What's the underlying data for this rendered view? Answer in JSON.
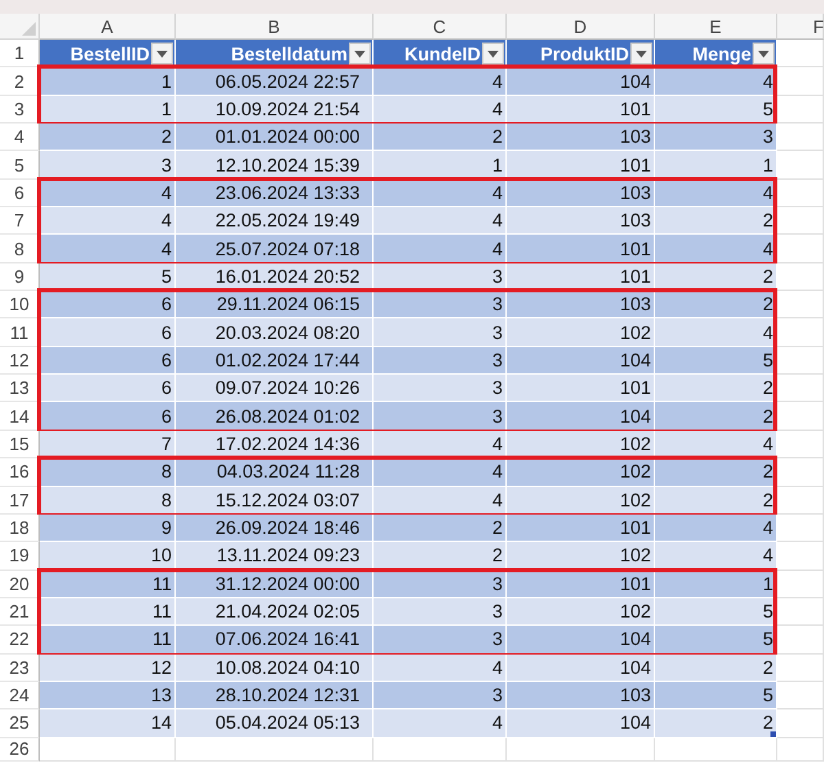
{
  "columns": [
    "A",
    "B",
    "C",
    "D",
    "E",
    "F"
  ],
  "header": {
    "row": "1",
    "cells": [
      "BestellID",
      "Bestelldatum",
      "KundeID",
      "ProduktID",
      "Menge"
    ]
  },
  "groups": [
    {
      "outlined": true,
      "rows": [
        {
          "row": "2",
          "cells": [
            "1",
            "06.05.2024 22:57",
            "4",
            "104",
            "4"
          ]
        },
        {
          "row": "3",
          "cells": [
            "1",
            "10.09.2024 21:54",
            "4",
            "101",
            "5"
          ]
        }
      ]
    },
    {
      "outlined": false,
      "rows": [
        {
          "row": "4",
          "cells": [
            "2",
            "01.01.2024 00:00",
            "2",
            "103",
            "3"
          ]
        },
        {
          "row": "5",
          "cells": [
            "3",
            "12.10.2024 15:39",
            "1",
            "101",
            "1"
          ]
        }
      ]
    },
    {
      "outlined": true,
      "rows": [
        {
          "row": "6",
          "cells": [
            "4",
            "23.06.2024 13:33",
            "4",
            "103",
            "4"
          ]
        },
        {
          "row": "7",
          "cells": [
            "4",
            "22.05.2024 19:49",
            "4",
            "103",
            "2"
          ]
        },
        {
          "row": "8",
          "cells": [
            "4",
            "25.07.2024 07:18",
            "4",
            "101",
            "4"
          ]
        }
      ]
    },
    {
      "outlined": false,
      "rows": [
        {
          "row": "9",
          "cells": [
            "5",
            "16.01.2024 20:52",
            "3",
            "101",
            "2"
          ]
        }
      ]
    },
    {
      "outlined": true,
      "rows": [
        {
          "row": "10",
          "cells": [
            "6",
            "29.11.2024 06:15",
            "3",
            "103",
            "2"
          ]
        },
        {
          "row": "11",
          "cells": [
            "6",
            "20.03.2024 08:20",
            "3",
            "102",
            "4"
          ]
        },
        {
          "row": "12",
          "cells": [
            "6",
            "01.02.2024 17:44",
            "3",
            "104",
            "5"
          ]
        },
        {
          "row": "13",
          "cells": [
            "6",
            "09.07.2024 10:26",
            "3",
            "101",
            "2"
          ]
        },
        {
          "row": "14",
          "cells": [
            "6",
            "26.08.2024 01:02",
            "3",
            "104",
            "2"
          ]
        }
      ]
    },
    {
      "outlined": false,
      "rows": [
        {
          "row": "15",
          "cells": [
            "7",
            "17.02.2024 14:36",
            "4",
            "102",
            "4"
          ]
        }
      ]
    },
    {
      "outlined": true,
      "rows": [
        {
          "row": "16",
          "cells": [
            "8",
            "04.03.2024 11:28",
            "4",
            "102",
            "2"
          ]
        },
        {
          "row": "17",
          "cells": [
            "8",
            "15.12.2024 03:07",
            "4",
            "102",
            "2"
          ]
        }
      ]
    },
    {
      "outlined": false,
      "rows": [
        {
          "row": "18",
          "cells": [
            "9",
            "26.09.2024 18:46",
            "2",
            "101",
            "4"
          ]
        },
        {
          "row": "19",
          "cells": [
            "10",
            "13.11.2024 09:23",
            "2",
            "102",
            "4"
          ]
        }
      ]
    },
    {
      "outlined": true,
      "rows": [
        {
          "row": "20",
          "cells": [
            "11",
            "31.12.2024 00:00",
            "3",
            "101",
            "1"
          ]
        },
        {
          "row": "21",
          "cells": [
            "11",
            "21.04.2024 02:05",
            "3",
            "102",
            "5"
          ]
        },
        {
          "row": "22",
          "cells": [
            "11",
            "07.06.2024 16:41",
            "3",
            "104",
            "5"
          ]
        }
      ]
    },
    {
      "outlined": false,
      "rows": [
        {
          "row": "23",
          "cells": [
            "12",
            "10.08.2024 04:10",
            "4",
            "104",
            "2"
          ]
        },
        {
          "row": "24",
          "cells": [
            "13",
            "28.10.2024 12:31",
            "3",
            "103",
            "5"
          ]
        },
        {
          "row": "25",
          "cells": [
            "14",
            "05.04.2024 05:13",
            "4",
            "104",
            "2"
          ]
        }
      ]
    }
  ],
  "blank_rows": [
    "26"
  ]
}
